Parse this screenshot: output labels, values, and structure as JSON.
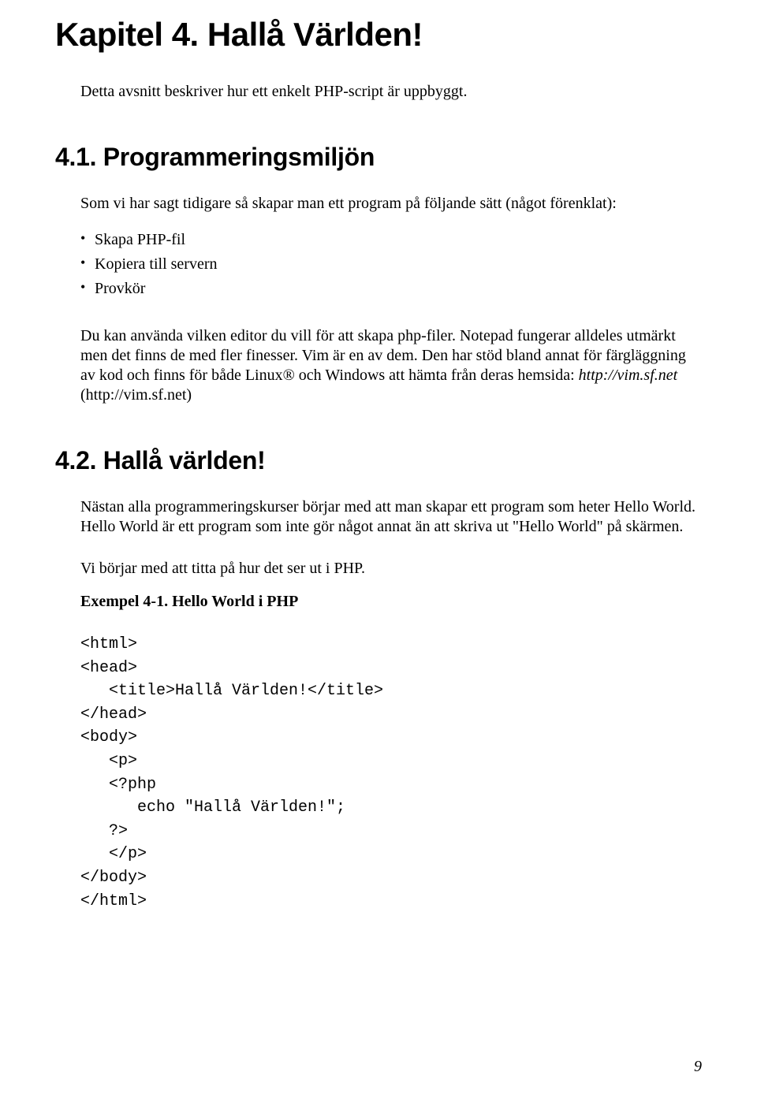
{
  "chapter": {
    "title": "Kapitel 4. Hallå Världen!",
    "intro": "Detta avsnitt beskriver hur ett enkelt PHP-script är uppbyggt."
  },
  "sections": {
    "s1": {
      "title": "4.1. Programmeringsmiljön",
      "lead": "Som vi har sagt tidigare så skapar man ett program på följande sätt (något förenklat):",
      "bullets": [
        "Skapa PHP-fil",
        "Kopiera till servern",
        "Provkör"
      ],
      "p2_a": "Du kan använda vilken editor du vill för att skapa php-filer. Notepad fungerar alldeles utmärkt men det finns de med fler finesser. Vim är en av dem. Den har stöd bland annat för färgläggning av kod och finns för både Linux® och Windows att hämta från deras hemsida: ",
      "p2_link_text": "http://vim.sf.net",
      "p2_b": " (http://vim.sf.net)"
    },
    "s2": {
      "title": "4.2. Hallå världen!",
      "p1": "Nästan alla programmeringskurser börjar med att man skapar ett program som heter Hello World. Hello World är ett program som inte gör något annat än att skriva ut \"Hello World\" på skärmen.",
      "p2": "Vi börjar med att titta på hur det ser ut i PHP.",
      "example_title": "Exempel 4-1. Hello World i PHP",
      "code": "<html>\n<head>\n   <title>Hallå Världen!</title>\n</head>\n<body>\n   <p>\n   <?php\n      echo \"Hallå Världen!\";\n   ?>\n   </p>\n</body>\n</html>"
    }
  },
  "page_number": "9"
}
